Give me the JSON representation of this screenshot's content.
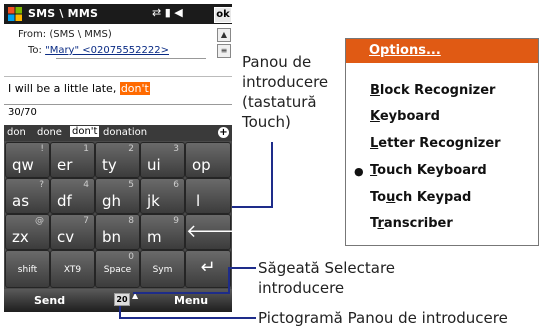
{
  "phone": {
    "title": "SMS \\ MMS",
    "ok_label": "ok",
    "from_label": "From:",
    "from_value": "(SMS \\ MMS)",
    "to_label": "To:",
    "to_value": "\"Mary\" <02075552222>",
    "message_text": "I will be a little late, ",
    "message_highlight": "don't",
    "char_count": "30/70",
    "suggestions": [
      "don",
      "done",
      "don't",
      "donation"
    ],
    "keyboard": {
      "row1": [
        {
          "main": "qw",
          "sub": "!"
        },
        {
          "main": "er",
          "sub": "1"
        },
        {
          "main": "ty",
          "sub": "2"
        },
        {
          "main": "ui",
          "sub": "3"
        },
        {
          "main": "op",
          "sub": ""
        }
      ],
      "row2": [
        {
          "main": "as",
          "sub": "?"
        },
        {
          "main": "df",
          "sub": "4"
        },
        {
          "main": "gh",
          "sub": "5"
        },
        {
          "main": "jk",
          "sub": "6"
        },
        {
          "main": "l",
          "sub": ""
        }
      ],
      "row3": [
        {
          "main": "zx",
          "sub": "@"
        },
        {
          "main": "cv",
          "sub": "7"
        },
        {
          "main": "bn",
          "sub": "8"
        },
        {
          "main": "m",
          "sub": "9"
        }
      ],
      "row4": [
        {
          "label": "shift"
        },
        {
          "label": "XT9"
        },
        {
          "label": "Space",
          "sub": "0"
        },
        {
          "label": "Sym"
        }
      ]
    },
    "softkey_left": "Send",
    "softkey_right": "Menu",
    "sip_icon_text": "20"
  },
  "callouts": {
    "input_panel": [
      "Panou de",
      "introducere",
      "(tastatură",
      "Touch)"
    ],
    "selector_arrow": [
      "Săgeată Selectare",
      "introducere"
    ],
    "panel_icon": "Pictogramă Panou de introducere"
  },
  "options_menu": {
    "title": "Options...",
    "items": [
      {
        "label": "Block Recognizer",
        "underline": "B",
        "rest": "lock Recognizer",
        "selected": false
      },
      {
        "label": "Keyboard",
        "underline": "K",
        "rest": "eyboard",
        "selected": false
      },
      {
        "label": "Letter Recognizer",
        "underline": "L",
        "rest": "etter Recognizer",
        "selected": false
      },
      {
        "label": "Touch Keyboard",
        "underline": "T",
        "rest": "ouch Keyboard",
        "selected": true
      },
      {
        "label": "Touch Keypad",
        "underline": "",
        "rest": "",
        "selected": false
      },
      {
        "label": "Transcriber",
        "underline": "",
        "rest": "",
        "selected": false
      }
    ]
  },
  "colors": {
    "accent": "#e05a14",
    "callout_line": "#1e2c8a",
    "highlight": "#ff6a00"
  }
}
